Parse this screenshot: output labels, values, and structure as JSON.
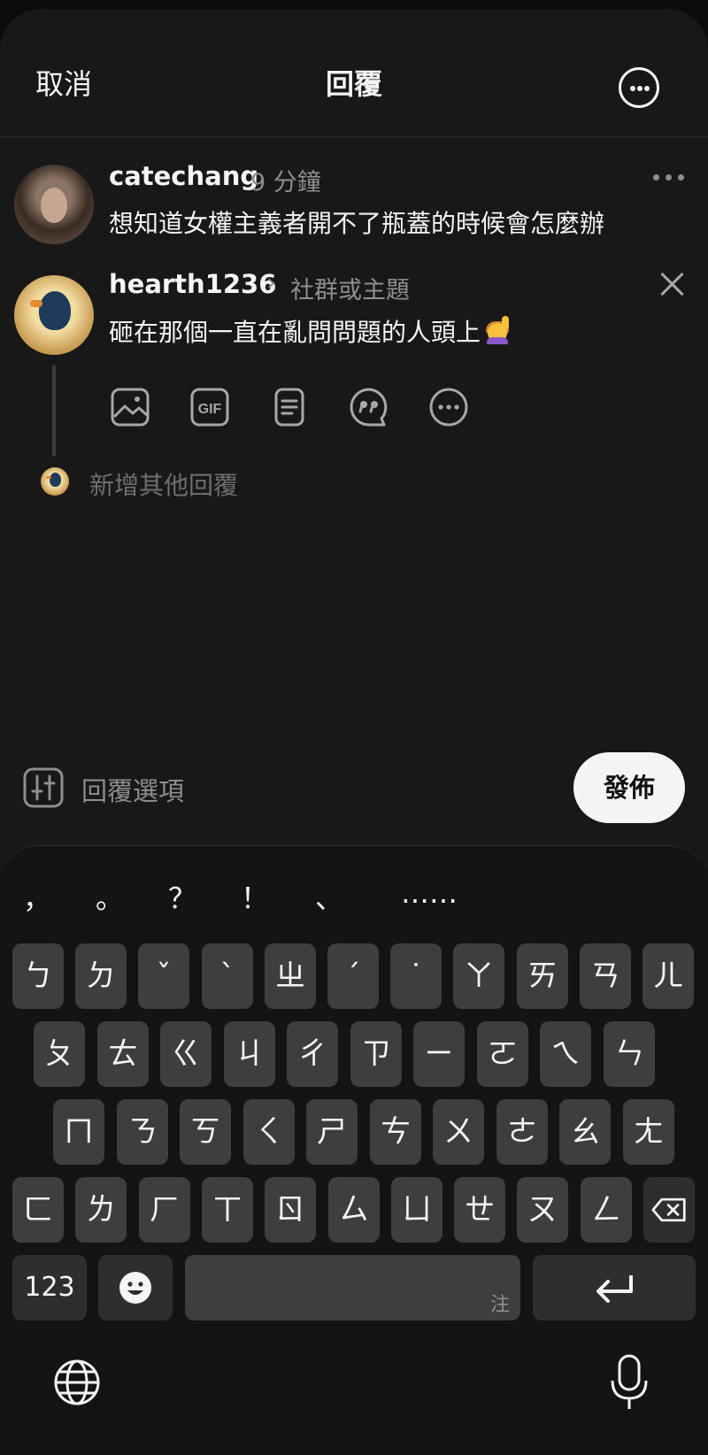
{
  "header": {
    "cancel_label": "取消",
    "title": "回覆",
    "more_icon": "more-circle-icon"
  },
  "original_post": {
    "username": "catechang",
    "time": "9 分鐘",
    "text": "想知道女權主義者開不了瓶蓋的時候會怎麼辦"
  },
  "reply": {
    "username": "hearth1236",
    "topic_placeholder": "社群或主題",
    "text": "砸在那個一直在亂問問題的人頭上",
    "emoji": "person-raising-hand-emoji",
    "attachments": [
      "image-icon",
      "gif-icon",
      "poll-icon",
      "quote-icon",
      "more-icon"
    ]
  },
  "add_reply_placeholder": "新增其他回覆",
  "reply_options_label": "回覆選項",
  "publish_label": "發佈",
  "keyboard": {
    "punctuation": [
      "，",
      "。",
      "？",
      "！",
      "、",
      "……"
    ],
    "row1": [
      "ㄅ",
      "ㄉ",
      "ˇ",
      "ˋ",
      "ㄓ",
      "ˊ",
      "˙",
      "ㄚ",
      "ㄞ",
      "ㄢ",
      "ㄦ"
    ],
    "row2": [
      "ㄆ",
      "ㄊ",
      "ㄍ",
      "ㄐ",
      "ㄔ",
      "ㄗ",
      "ㄧ",
      "ㄛ",
      "ㄟ",
      "ㄣ"
    ],
    "row3": [
      "ㄇ",
      "ㄋ",
      "ㄎ",
      "ㄑ",
      "ㄕ",
      "ㄘ",
      "ㄨ",
      "ㄜ",
      "ㄠ",
      "ㄤ"
    ],
    "row4": [
      "ㄈ",
      "ㄌ",
      "ㄏ",
      "ㄒ",
      "ㄖ",
      "ㄙ",
      "ㄩ",
      "ㄝ",
      "ㄡ",
      "ㄥ"
    ],
    "numbers_label": "123",
    "space_hint": "注",
    "backspace_icon": "backspace-icon",
    "return_icon": "return-icon",
    "emoji_icon": "emoji-icon",
    "globe_icon": "globe-icon",
    "mic_icon": "microphone-icon"
  }
}
